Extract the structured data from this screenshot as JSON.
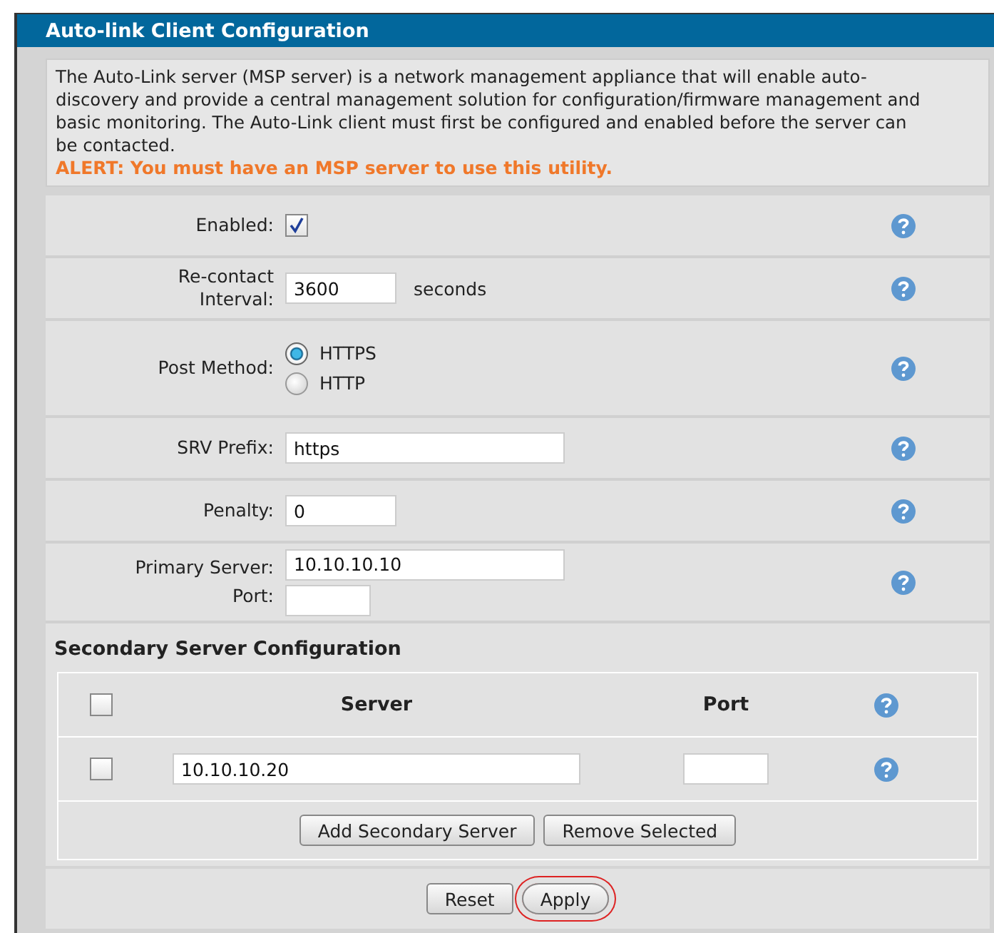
{
  "title": "Auto-link Client Configuration",
  "intro": {
    "text": "The Auto-Link server (MSP server) is a network management appliance that will enable auto-discovery and provide a central management solution for configuration/firmware management and basic monitoring. The Auto-Link client must first be configured and enabled before the server can be contacted.",
    "alert": "ALERT: You must have an MSP server to use this utility."
  },
  "fields": [
    {
      "kind": "checkbox",
      "label": [
        "Enabled:"
      ],
      "checked": true
    },
    {
      "kind": "text",
      "label": [
        "Re-contact",
        "Interval:"
      ],
      "value": "3600",
      "unit": "seconds"
    },
    {
      "kind": "radio",
      "label": [
        "Post Method:"
      ],
      "options": [
        {
          "label": "HTTPS",
          "selected": true
        },
        {
          "label": "HTTP",
          "selected": false
        }
      ]
    },
    {
      "kind": "wide-text",
      "label": [
        "SRV Prefix:"
      ],
      "value": "https"
    },
    {
      "kind": "text",
      "label": [
        "Penalty:"
      ],
      "value": "0"
    },
    {
      "kind": "server",
      "label": [
        "Primary Server:"
      ],
      "value": "10.10.10.10",
      "port_label": "Port:"
    }
  ],
  "secondary": {
    "title": "Secondary Server Configuration",
    "header_checked": false,
    "columns": [
      "Server",
      "Port"
    ],
    "rows": [
      {
        "checked": false,
        "server": "10.10.10.20"
      }
    ],
    "buttons": [
      "Add Secondary Server",
      "Remove Selected"
    ]
  },
  "actions": [
    {
      "label": "Reset",
      "circled": false
    },
    {
      "label": "Apply",
      "circled": true
    }
  ]
}
